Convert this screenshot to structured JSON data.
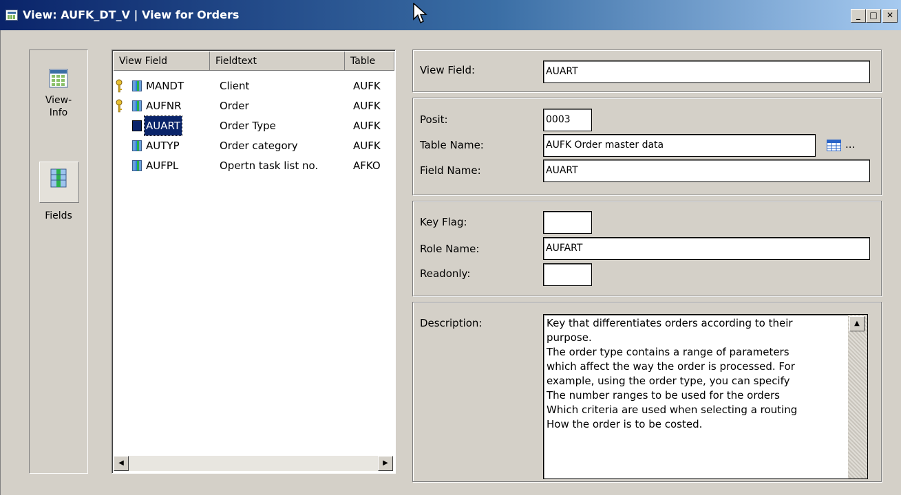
{
  "window": {
    "title": "View: AUFK_DT_V | View for Orders",
    "minimize_label": "_",
    "restore_label": "□",
    "close_label": "✕"
  },
  "nav": {
    "items": [
      {
        "label": "View-\nInfo",
        "icon": "table-grid-icon"
      },
      {
        "label": "Fields",
        "icon": "fields-icon"
      }
    ],
    "selected": "Fields"
  },
  "list": {
    "columns": [
      "View Field",
      "Fieldtext",
      "Table"
    ],
    "rows": [
      {
        "view_field": "MANDT",
        "fieldtext": "Client",
        "table": "AUFK",
        "key": true
      },
      {
        "view_field": "AUFNR",
        "fieldtext": "Order",
        "table": "AUFK",
        "key": true
      },
      {
        "view_field": "AUART",
        "fieldtext": "Order Type",
        "table": "AUFK",
        "key": false,
        "selected": true
      },
      {
        "view_field": "AUTYP",
        "fieldtext": "Order category",
        "table": "AUFK",
        "key": false
      },
      {
        "view_field": "AUFPL",
        "fieldtext": "Opertn task list no.",
        "table": "AFKO",
        "key": false
      }
    ],
    "scroll_left": "◀",
    "scroll_right": "▶"
  },
  "details": {
    "view_field": {
      "label": "View Field:",
      "value": "AUART"
    },
    "posit": {
      "label": "Posit:",
      "value": "0003"
    },
    "table_name": {
      "label": "Table Name:",
      "value": "AUFK Order master data",
      "more": "..."
    },
    "field_name": {
      "label": "Field Name:",
      "value": "AUART"
    },
    "key_flag": {
      "label": "Key Flag:",
      "value": ""
    },
    "role_name": {
      "label": "Role Name:",
      "value": "AUFART"
    },
    "readonly": {
      "label": "Readonly:",
      "value": ""
    },
    "description": {
      "label": "Description:",
      "text": "Key that differentiates orders according to their\npurpose.\nThe order type contains a range of parameters\nwhich affect the way the order is processed. For\nexample, using the order type, you can specify\nThe number ranges to be used for the orders\nWhich criteria are used when selecting a routing\nHow the order is to be costed.",
      "scroll_up": "▲"
    }
  }
}
